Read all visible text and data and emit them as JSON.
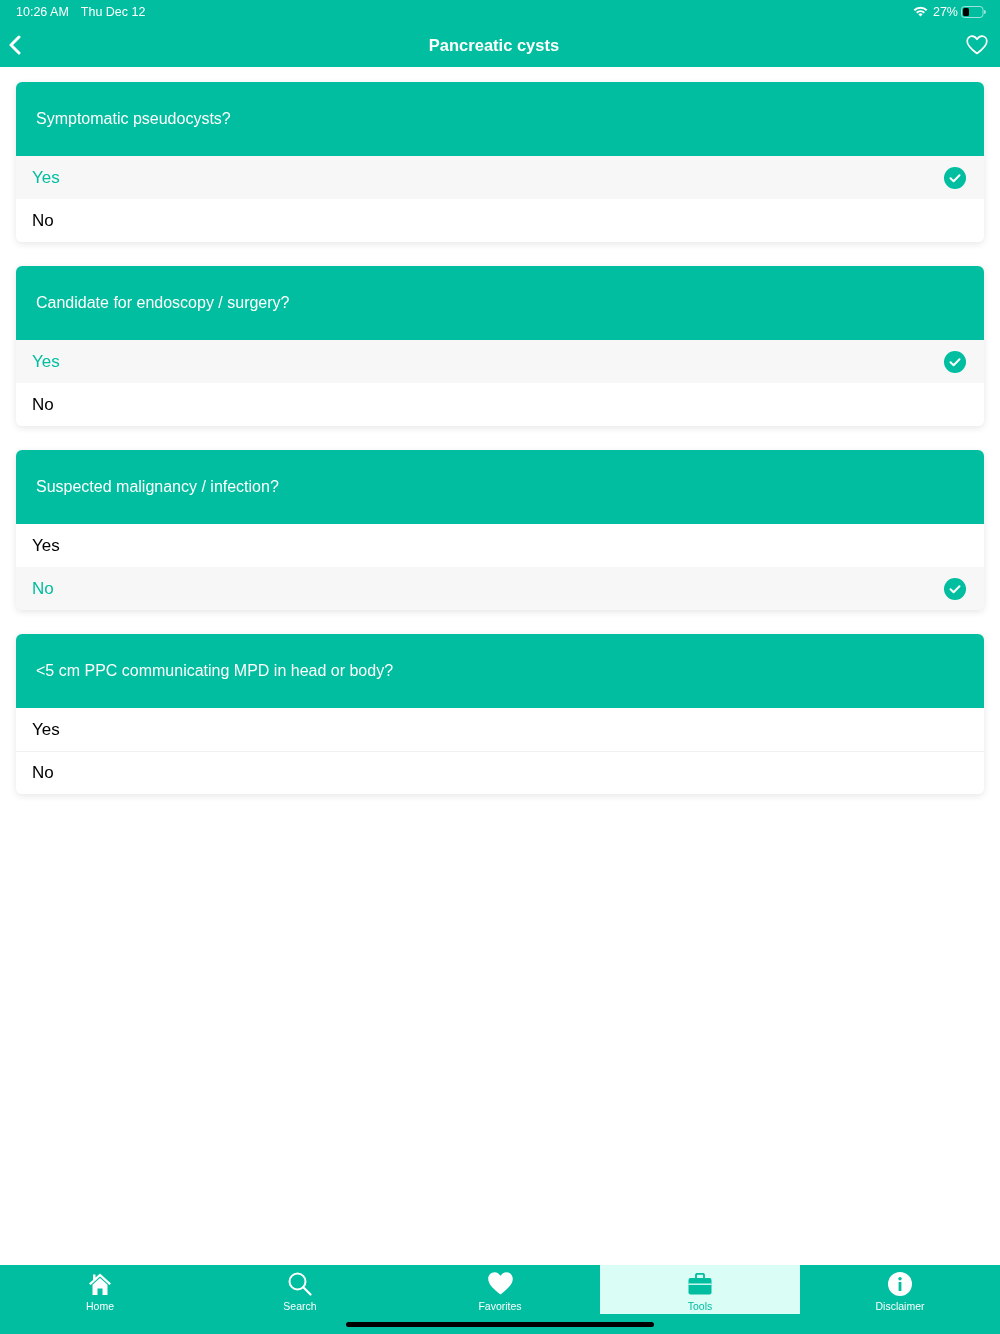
{
  "status_bar": {
    "time": "10:26 AM",
    "date": "Thu Dec 12",
    "battery": "27%"
  },
  "nav_bar": {
    "title": "Pancreatic cysts"
  },
  "questions": [
    {
      "question": "Symptomatic pseudocysts?",
      "options": [
        {
          "label": "Yes",
          "selected": true
        },
        {
          "label": "No",
          "selected": false
        }
      ]
    },
    {
      "question": "Candidate for endoscopy / surgery?",
      "options": [
        {
          "label": "Yes",
          "selected": true
        },
        {
          "label": "No",
          "selected": false
        }
      ]
    },
    {
      "question": "Suspected malignancy / infection?",
      "options": [
        {
          "label": "Yes",
          "selected": false
        },
        {
          "label": "No",
          "selected": true
        }
      ]
    },
    {
      "question": "<5 cm PPC communicating MPD in head or body?",
      "options": [
        {
          "label": "Yes",
          "selected": false
        },
        {
          "label": "No",
          "selected": false
        }
      ]
    }
  ],
  "tab_bar": {
    "tabs": [
      {
        "label": "Home",
        "kind": "home",
        "selected": false
      },
      {
        "label": "Search",
        "kind": "search",
        "selected": false
      },
      {
        "label": "Favorites",
        "kind": "favorites",
        "selected": false
      },
      {
        "label": "Tools",
        "kind": "tools",
        "selected": true
      },
      {
        "label": "Disclaimer",
        "kind": "disclaimer",
        "selected": false
      }
    ]
  }
}
